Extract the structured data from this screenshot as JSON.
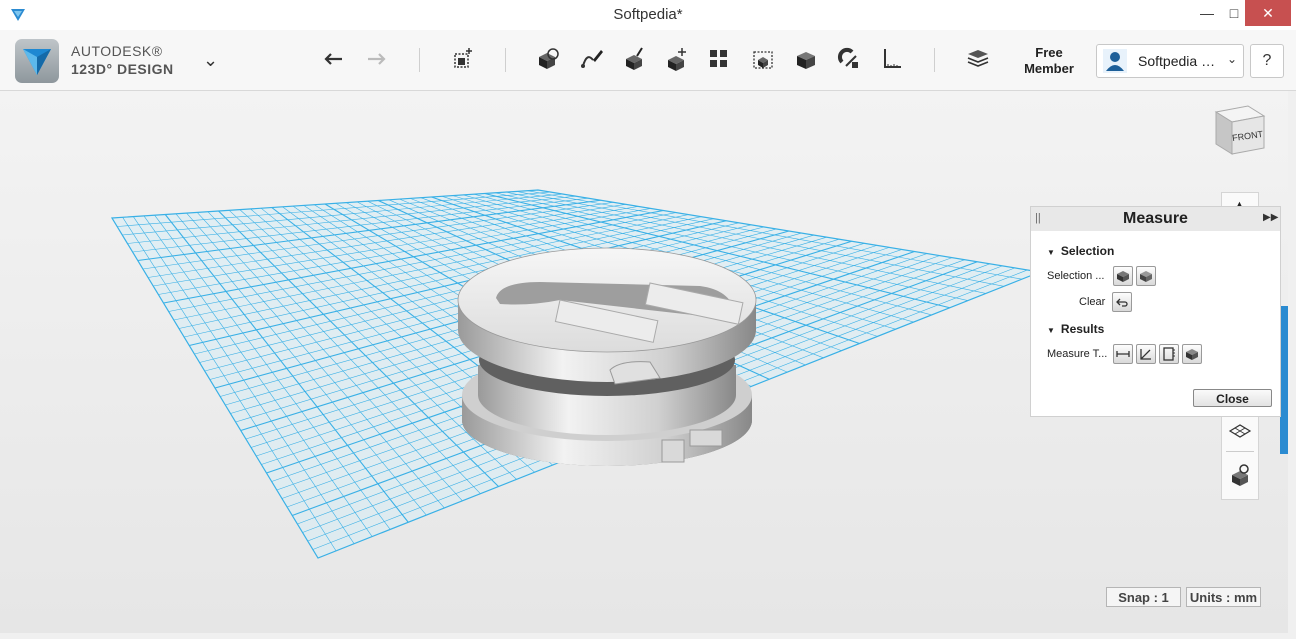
{
  "window": {
    "title": "Softpedia*",
    "minimize": "—",
    "maximize": "□",
    "close": "✕"
  },
  "brand": {
    "line1": "AUTODESK®",
    "line2": "123D° DESIGN"
  },
  "toolbar": {
    "tools": [
      "undo-icon",
      "redo-icon",
      "primitives-icon",
      "sketch-icon",
      "construct-icon",
      "modify-icon",
      "pattern-icon",
      "grouping-icon",
      "combine-icon",
      "snap-icon",
      "measure-icon",
      "material-icon"
    ],
    "member_line1": "Free",
    "member_line2": "Member",
    "user_name": "Softpedia",
    "user_more": "…",
    "help": "?"
  },
  "view_cube": {
    "face": "FRONT"
  },
  "measure_panel": {
    "title": "Measure",
    "selection_header": "Selection",
    "selection_label": "Selection ...",
    "clear_label": "Clear",
    "results_header": "Results",
    "measure_label": "Measure T...",
    "close_label": "Close"
  },
  "status": {
    "snap": "Snap : 1",
    "units": "Units : mm"
  },
  "colors": {
    "grid": "#39b0e6",
    "accent": "#2b8bd1",
    "close_button": "#c75050"
  }
}
